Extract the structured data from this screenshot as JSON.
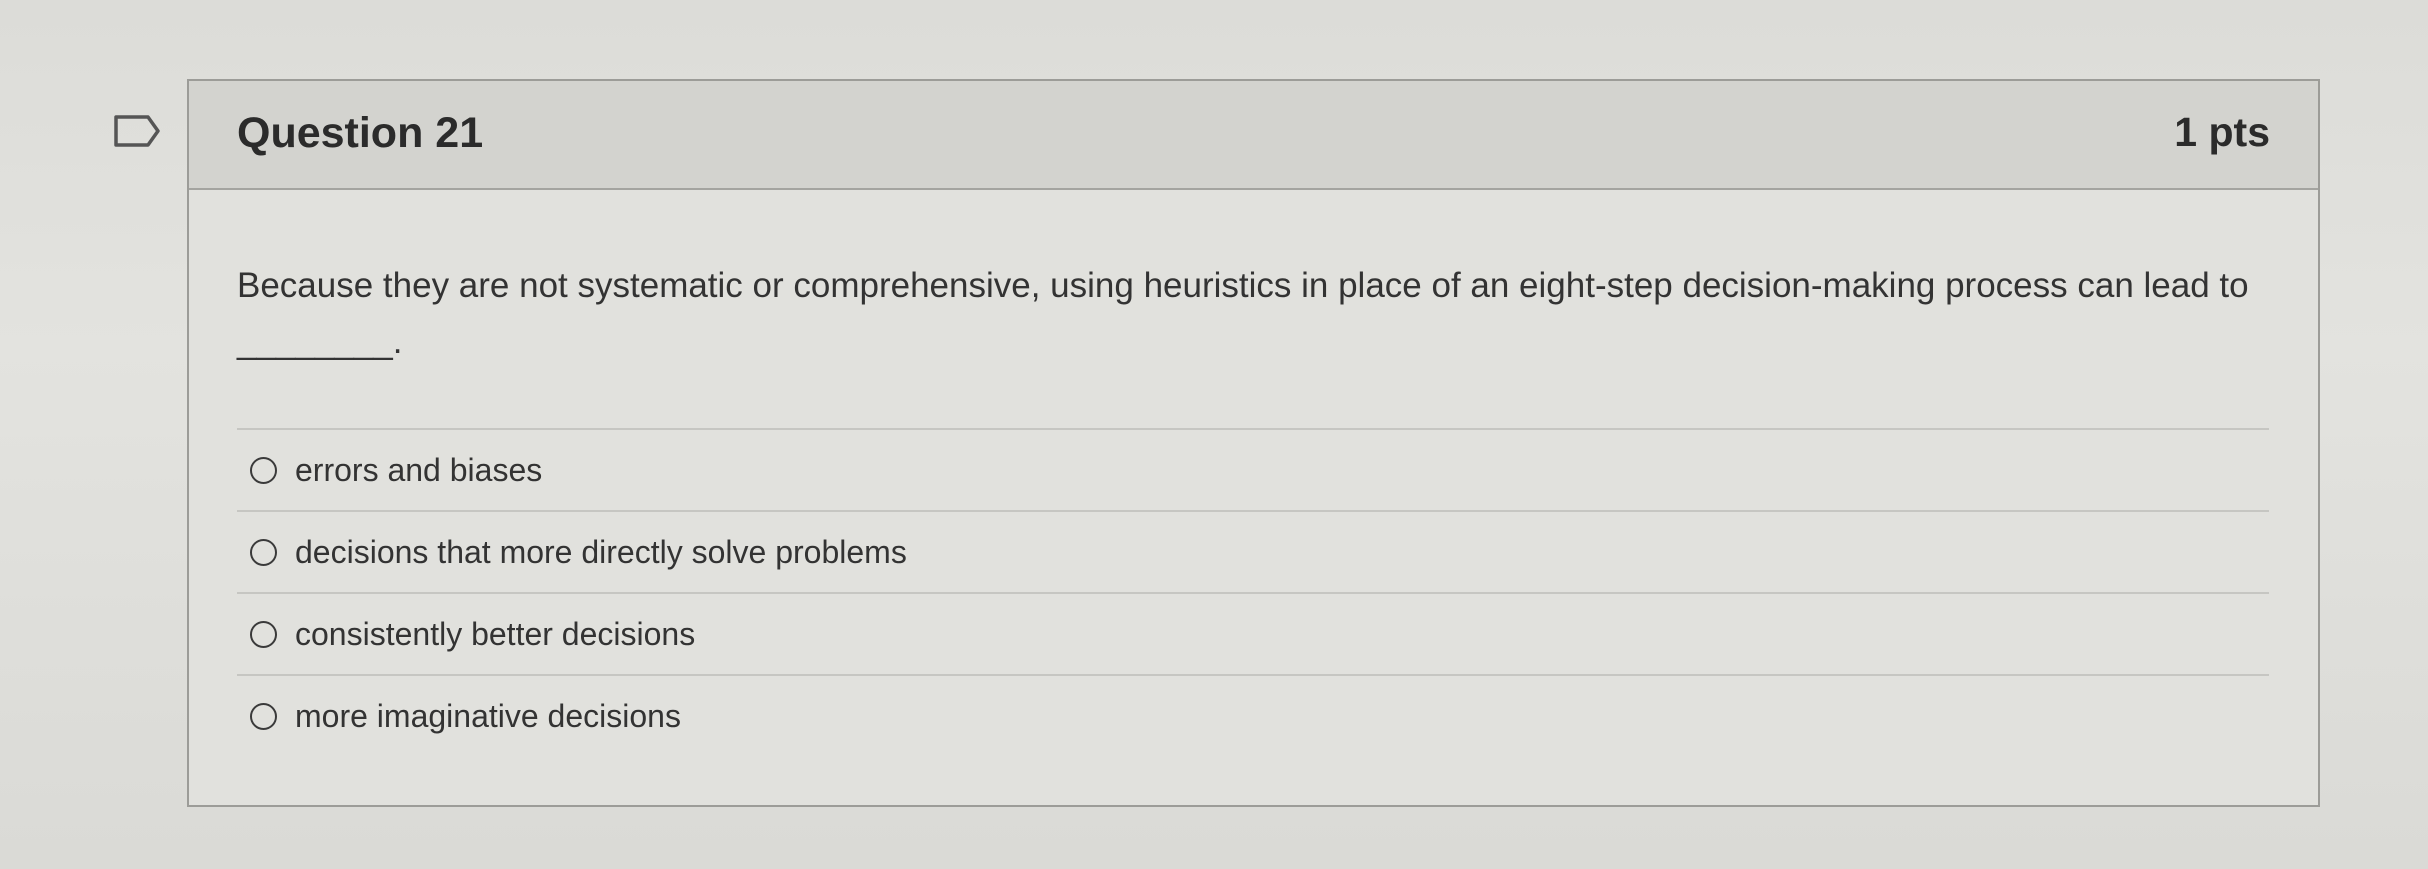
{
  "question": {
    "title": "Question 21",
    "points": "1 pts",
    "text": "Because they are not systematic or comprehensive, using heuristics in place of an eight-step decision-making process can lead to ________."
  },
  "flag_icon": "flag-outline-icon",
  "answers": [
    {
      "label": "errors and biases"
    },
    {
      "label": "decisions that more directly solve problems"
    },
    {
      "label": "consistently better decisions"
    },
    {
      "label": "more imaginative decisions"
    }
  ],
  "colors": {
    "background": "#e1e1dd",
    "header": "#d3d3cf",
    "border": "#9c9c98",
    "text": "#333333"
  }
}
